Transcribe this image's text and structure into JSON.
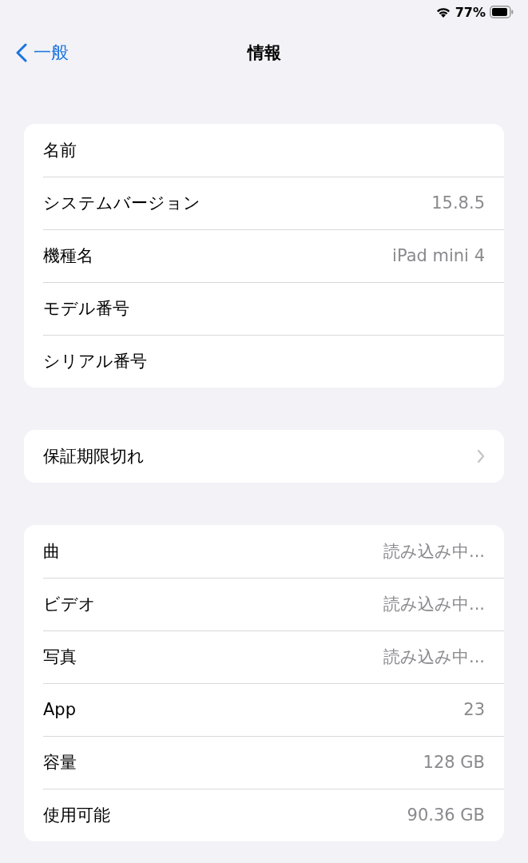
{
  "status_bar": {
    "battery_percent": "77%"
  },
  "nav": {
    "back": "一般",
    "title": "情報"
  },
  "groups": [
    {
      "rows": [
        {
          "kind": "value",
          "label": "名前"
        },
        {
          "kind": "value",
          "label": "システムバージョン",
          "value": "15.8.5"
        },
        {
          "kind": "value",
          "label": "機種名",
          "value": "iPad mini 4"
        },
        {
          "kind": "value",
          "label": "モデル番号"
        },
        {
          "kind": "value",
          "label": "シリアル番号"
        }
      ]
    },
    {
      "rows": [
        {
          "kind": "link",
          "label": "保証期限切れ"
        }
      ]
    },
    {
      "rows": [
        {
          "kind": "value",
          "label": "曲",
          "value": "読み込み中..."
        },
        {
          "kind": "value",
          "label": "ビデオ",
          "value": "読み込み中..."
        },
        {
          "kind": "value",
          "label": "写真",
          "value": "読み込み中..."
        },
        {
          "kind": "value",
          "label": "App",
          "value": "23"
        },
        {
          "kind": "value",
          "label": "容量",
          "value": "128 GB"
        },
        {
          "kind": "value",
          "label": "使用可能",
          "value": "90.36 GB"
        }
      ]
    }
  ]
}
